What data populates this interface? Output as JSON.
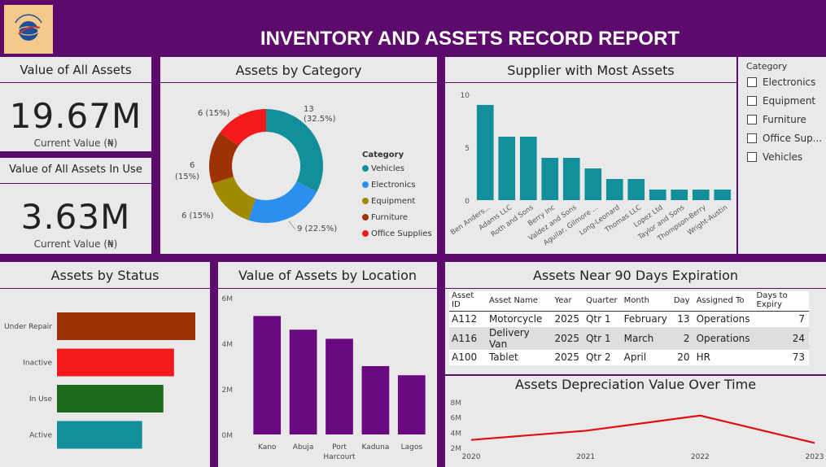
{
  "header": {
    "title": "INVENTORY AND ASSETS RECORD REPORT",
    "logo_icon": "company-logo"
  },
  "kpi_total": {
    "title": "Value of All Assets",
    "value": "19.67M",
    "label": "Current Value (₦)"
  },
  "kpi_in_use": {
    "title": "Value of All Assets In Use",
    "value": "3.63M",
    "label": "Current Value (₦)"
  },
  "category_chart": {
    "title": "Assets by Category",
    "legend_title": "Category",
    "legend": [
      "Vehicles",
      "Electronics",
      "Equipment",
      "Furniture",
      "Office Supplies"
    ],
    "slice_labels": [
      "13\n(32.5%)",
      "9 (22.5%)",
      "6 (15%)",
      "6\n(15%)",
      "6 (15%)"
    ]
  },
  "supplier_chart": {
    "title": "Supplier with Most Assets",
    "yticks": [
      "0",
      "5",
      "10"
    ],
    "xlabels": [
      "Ben Anders...",
      "Adams LLC",
      "Roth and Sons",
      "Berry Inc",
      "Valdez and Sons",
      "Aguilar, Gilmore ...",
      "Long-Leonard",
      "Thomas LLC",
      "Lopez Ltd",
      "Taylor and Sons",
      "Thompson-Berry",
      "Wright-Austin"
    ]
  },
  "category_filter": {
    "title": "Category",
    "items": [
      "Electronics",
      "Equipment",
      "Furniture",
      "Office Sup...",
      "Vehicles"
    ]
  },
  "status_chart": {
    "title": "Assets by Status",
    "labels": [
      "Under Repair",
      "Inactive",
      "In Use",
      "Active"
    ]
  },
  "location_chart": {
    "title": "Value of Assets by Location",
    "yticks": [
      "0M",
      "2M",
      "4M",
      "6M"
    ],
    "xlabels": [
      "Kano",
      "Abuja",
      "Port Harcourt",
      "Kaduna",
      "Lagos"
    ]
  },
  "expiry_table": {
    "title": "Assets Near 90 Days Expiration",
    "columns": [
      "Asset ID",
      "Asset Name",
      "Year",
      "Quarter",
      "Month",
      "Day",
      "Assigned To",
      "Days to Expiry"
    ],
    "rows": [
      [
        "A112",
        "Motorcycle",
        "2025",
        "Qtr 1",
        "February",
        "13",
        "Operations",
        "7"
      ],
      [
        "A116",
        "Delivery Van",
        "2025",
        "Qtr 1",
        "March",
        "2",
        "Operations",
        "24"
      ],
      [
        "A100",
        "Tablet",
        "2025",
        "Qtr 2",
        "April",
        "20",
        "HR",
        "73"
      ]
    ]
  },
  "depreciation_chart": {
    "title": "Assets Depreciation Value Over Time",
    "yticks": [
      "2M",
      "4M",
      "6M",
      "8M"
    ],
    "xlabels": [
      "2020",
      "2021",
      "2022",
      "2023"
    ]
  },
  "chart_data": [
    {
      "id": "category",
      "type": "pie",
      "title": "Assets by Category",
      "categories": [
        "Vehicles",
        "Electronics",
        "Equipment",
        "Furniture",
        "Office Supplies"
      ],
      "values": [
        13,
        9,
        6,
        6,
        6
      ],
      "colors": [
        "#138f9c",
        "#2b8ff0",
        "#a08a00",
        "#9e3204",
        "#f21a1a"
      ],
      "legend": "right"
    },
    {
      "id": "supplier",
      "type": "bar",
      "title": "Supplier with Most Assets",
      "categories": [
        "Ben Anders...",
        "Adams LLC",
        "Roth and Sons",
        "Berry Inc",
        "Valdez and Sons",
        "Aguilar, Gilmore ...",
        "Long-Leonard",
        "Thomas LLC",
        "Lopez Ltd",
        "Taylor and Sons",
        "Thompson-Berry",
        "Wright-Austin"
      ],
      "values": [
        9,
        6,
        6,
        4,
        4,
        3,
        2,
        2,
        1,
        1,
        1,
        1
      ],
      "ylim": [
        0,
        10
      ],
      "color": "#138f9c"
    },
    {
      "id": "status",
      "type": "bar",
      "orientation": "horizontal",
      "title": "Assets by Status",
      "categories": [
        "Under Repair",
        "Inactive",
        "In Use",
        "Active"
      ],
      "values": [
        13,
        11,
        10,
        8
      ],
      "colors": [
        "#9e3204",
        "#f21a1a",
        "#1e6b1e",
        "#138f9c"
      ]
    },
    {
      "id": "location",
      "type": "bar",
      "title": "Value of Assets by Location",
      "categories": [
        "Kano",
        "Abuja",
        "Port Harcourt",
        "Kaduna",
        "Lagos"
      ],
      "values": [
        5.2,
        4.6,
        4.2,
        3.0,
        2.6
      ],
      "ylim": [
        0,
        6
      ],
      "color": "#6b0a80"
    },
    {
      "id": "depreciation",
      "type": "line",
      "title": "Assets Depreciation Value Over Time",
      "x": [
        "2020",
        "2021",
        "2022",
        "2023"
      ],
      "values": [
        3.0,
        4.2,
        6.2,
        2.6
      ],
      "ylim": [
        2,
        8
      ],
      "color": "#e01010"
    }
  ]
}
